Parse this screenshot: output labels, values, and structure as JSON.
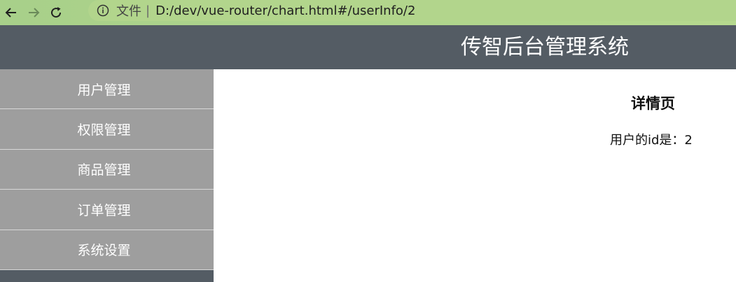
{
  "browser": {
    "back_icon": "arrow-left-icon",
    "forward_icon": "arrow-right-icon",
    "reload_icon": "reload-icon",
    "info_icon": "info-circle-icon",
    "scheme_label": "文件",
    "url": "D:/dev/vue-router/chart.html#/userInfo/2"
  },
  "header": {
    "title": "传智后台管理系统"
  },
  "sidebar": {
    "items": [
      {
        "label": "用户管理"
      },
      {
        "label": "权限管理"
      },
      {
        "label": "商品管理"
      },
      {
        "label": "订单管理"
      },
      {
        "label": "系统设置"
      }
    ]
  },
  "main": {
    "title": "详情页",
    "detail_text": "用户的id是：2"
  },
  "colors": {
    "header_bg": "#545c64",
    "menu_item_bg": "#9e9e9e",
    "toolbar_bg": "#b2d58c"
  }
}
